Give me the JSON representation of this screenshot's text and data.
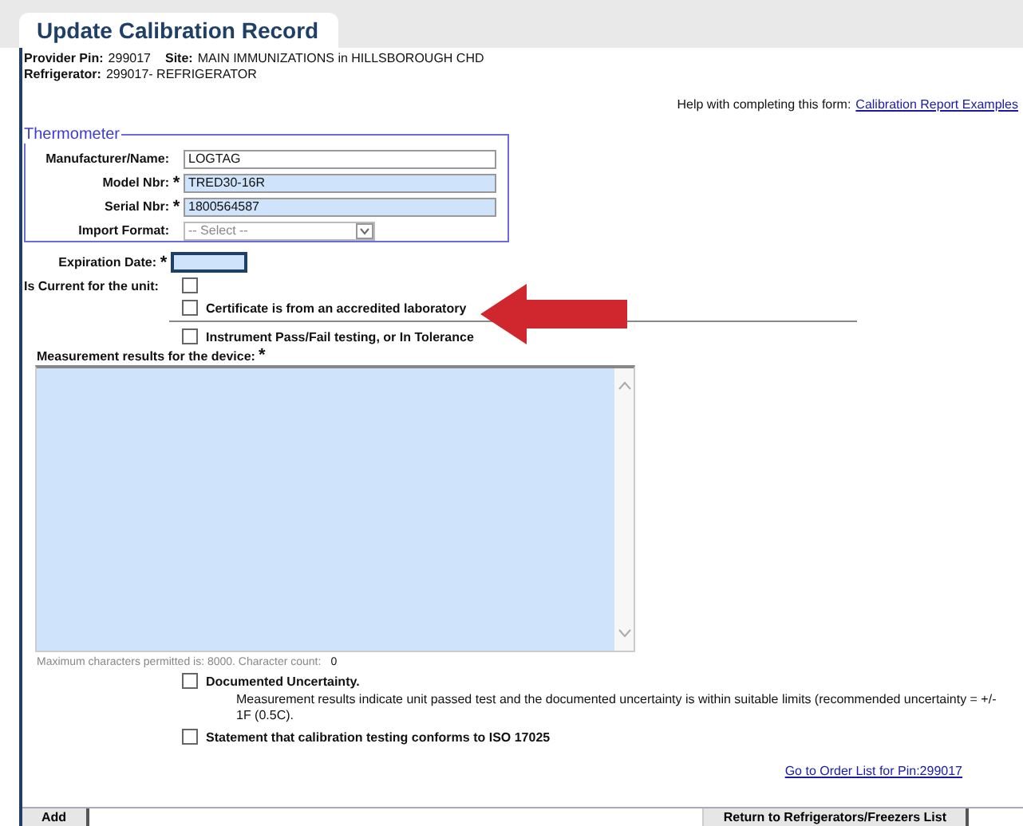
{
  "page_tab": {
    "label": "Update Calibration Record"
  },
  "info": [
    {
      "label": "Provider Pin:",
      "value": "299017"
    },
    {
      "label": "Site:",
      "value": "MAIN IMMUNIZATIONS in HILLSBOROUGH CHD"
    }
  ],
  "refrigerator": {
    "label": "Refrigerator:",
    "value": "299017- REFRIGERATOR"
  },
  "help": {
    "text": "Help with completing this form:",
    "link": "Calibration Report Examples"
  },
  "thermometer": {
    "legend": "Thermometer",
    "fields": [
      {
        "kind": "text",
        "label": "Manufacturer/Name:",
        "value": "LOGTAG"
      },
      {
        "kind": "text",
        "label": "Model Nbr:",
        "required_mark": "*",
        "value": "TRED30-16R"
      },
      {
        "kind": "text",
        "label": "Serial Nbr:",
        "required_mark": "*",
        "value": "1800564587"
      },
      {
        "kind": "select",
        "label": "Import Format:",
        "value": "-- Select --"
      }
    ]
  },
  "expiration": {
    "label": "Expiration Date:",
    "required_mark": "*"
  },
  "is_current": {
    "label": "Is Current for the unit:",
    "checked": false
  },
  "certificate": {
    "label": "Certificate is from an accredited laboratory",
    "checked": false
  },
  "instrument": {
    "label": "Instrument Pass/Fail testing, or In Tolerance",
    "checked": false
  },
  "measurement": {
    "label": "Measurement results for the device:",
    "required_mark": "*"
  },
  "char_count": {
    "text": "Maximum characters permitted is: 8000. Character count:",
    "count": "0"
  },
  "uncertainty": {
    "label": "Documented Uncertainty.",
    "checked": false,
    "description": "Measurement results indicate unit passed test and the documented uncertainty is within suitable limits (recommended uncertainty = +/- 1F (0.5C)."
  },
  "statement": {
    "label": "Statement that calibration testing conforms to ISO 17025",
    "checked": false
  },
  "order_link": "Go to Order List for Pin:299017",
  "buttons": [
    {
      "kind": "left",
      "label": "Add"
    },
    {
      "kind": "right",
      "label": "Return to Refrigerators/Freezers List"
    }
  ]
}
